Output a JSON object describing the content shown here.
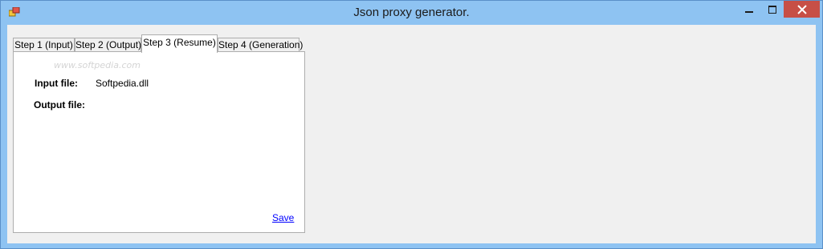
{
  "window": {
    "title": "Json proxy generator.",
    "icon": "app-icon",
    "controls": {
      "minimize_icon": "minimize-icon",
      "maximize_icon": "maximize-icon",
      "close_icon": "close-icon"
    },
    "colors": {
      "frame": "#8ec3f2",
      "close": "#c74f46"
    }
  },
  "tabs": [
    {
      "label": "Step 1 (Input)",
      "active": false
    },
    {
      "label": "Step 2 (Output)",
      "active": false
    },
    {
      "label": "Step 3 (Resume)",
      "active": true
    },
    {
      "label": "Step 4 (Generation)",
      "active": false
    }
  ],
  "resume": {
    "input_label": "Input file:",
    "input_value": "Softpedia.dll",
    "output_label": "Output file:",
    "output_value": "",
    "save_link": "Save"
  },
  "watermark": "www.softpedia.com"
}
